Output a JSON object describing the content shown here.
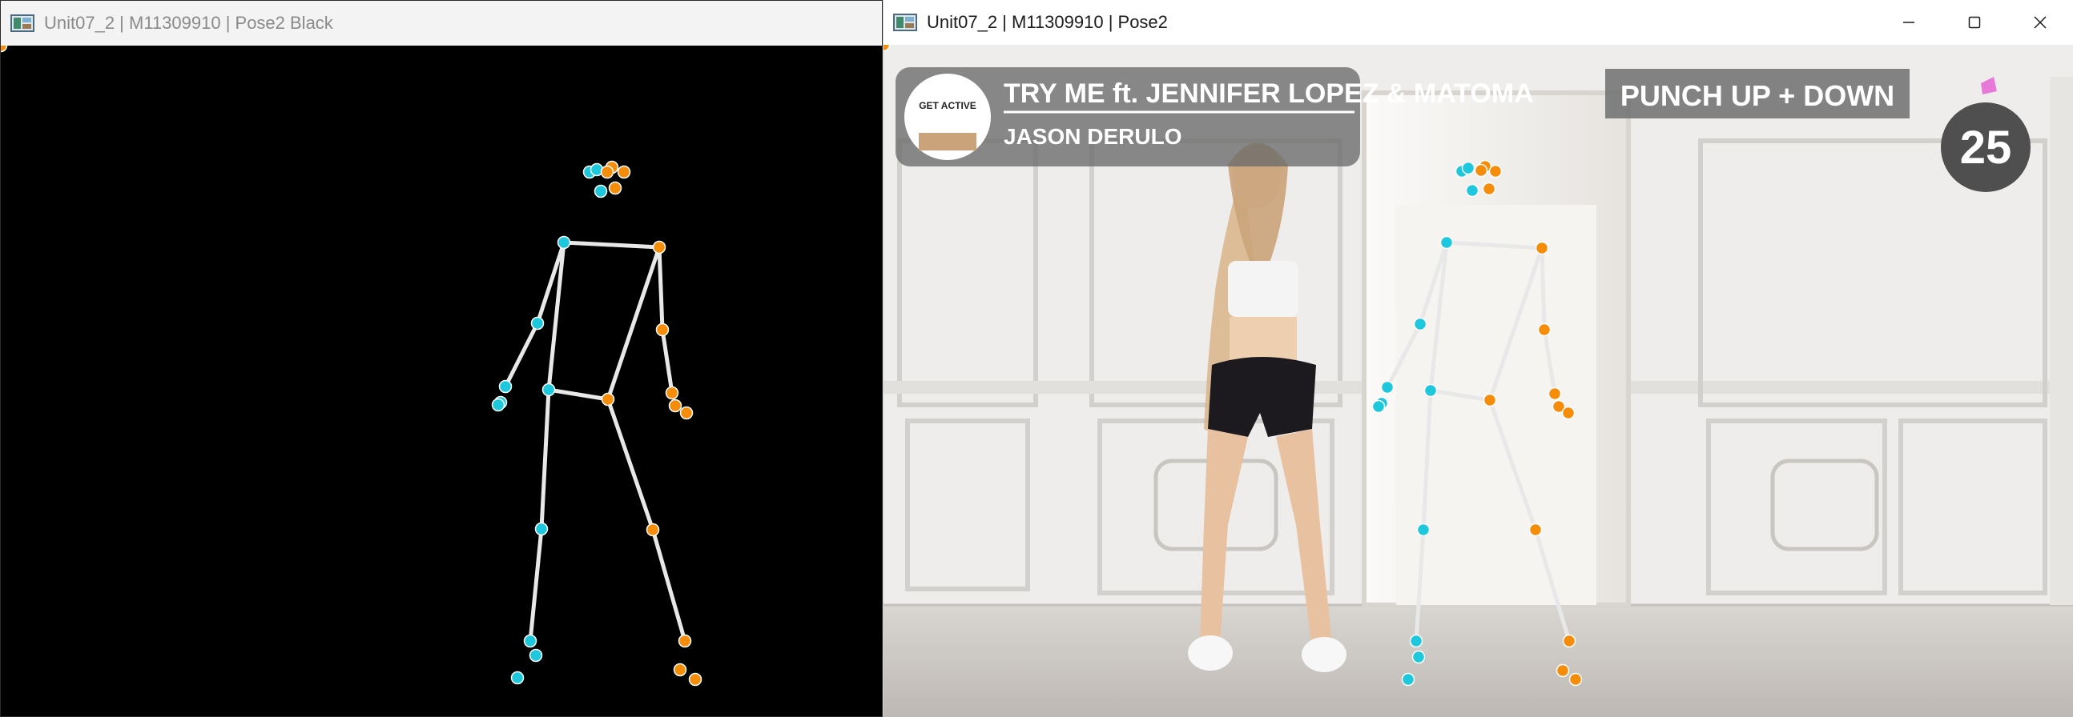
{
  "left_window": {
    "title": "Unit07_2 | M11309910 | Pose2 Black",
    "app_icon": "image-window-icon"
  },
  "right_window": {
    "title": "Unit07_2 | M11309910 | Pose2",
    "app_icon": "image-window-icon",
    "controls": {
      "minimize": "minimize-icon",
      "maximize": "maximize-icon",
      "close": "close-icon"
    },
    "video": {
      "album_badge": "GET ACTIVE",
      "song_title": "TRY ME ft. JENNIFER LOPEZ & MATOMA",
      "artist": "JASON DERULO",
      "exercise": "PUNCH UP + DOWN",
      "counter": "25"
    }
  },
  "colors": {
    "left_side": "#1ec8dc",
    "right_side": "#f58c0a",
    "bones": "#e8e8e8",
    "title_inactive": "#8a8a8a",
    "title_active": "#1b1b1b"
  }
}
